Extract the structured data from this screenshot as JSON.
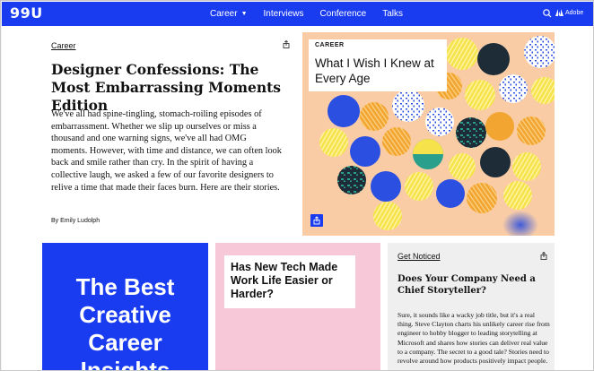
{
  "nav": {
    "logo": "99U",
    "links": [
      {
        "label": "Career",
        "has_dropdown": true
      },
      {
        "label": "Interviews"
      },
      {
        "label": "Conference"
      },
      {
        "label": "Talks"
      }
    ],
    "search_icon": "search-icon",
    "brand_label": "Adobe",
    "brand_icon": "adobe-logo-icon",
    "colors": {
      "nav_bg": "#1a3cf0"
    }
  },
  "feature": {
    "tag": "Career",
    "headline": "Designer Confessions: The Most Embarrassing Moments Edition",
    "excerpt": "We've all had spine-tingling, stomach-roiling episodes of embarrassment. Whether we slip up ourselves or miss a thousand and one warning signs, we've all had OMG moments. However, with time and distance, we can often look back and smile rather than cry. In the spirit of having a collective laugh, we asked a few of our favorite designers to relive a time that made their faces burn. Here are their stories.",
    "byline": "By Emily Ludolph",
    "share_icon": "share-icon"
  },
  "hero": {
    "tag": "CAREER",
    "title": "What I Wish I Knew at Every Age",
    "share_icon": "share-icon",
    "colors": {
      "bg": "#f9cca6",
      "accent": "#1a3cf0"
    }
  },
  "cards": {
    "blue": {
      "text": "The Best Creative Career Insights",
      "color": "#1a3cf0"
    },
    "pink": {
      "title": "Has New Tech Made Work Life Easier or Harder?",
      "color": "#f7c8d8"
    },
    "gray": {
      "tag": "Get Noticed",
      "title": "Does Your Company Need a Chief Storyteller?",
      "excerpt": "Sure, it sounds like a wacky job title, but it's a real thing. Steve Clayton charts his unlikely career rise from engineer to hobby blogger to leading storytelling at Microsoft and shares how stories can deliver real value to a company. The secret to a good tale? Stories need to revolve around how products positively impact people.",
      "share_icon": "share-icon"
    }
  }
}
